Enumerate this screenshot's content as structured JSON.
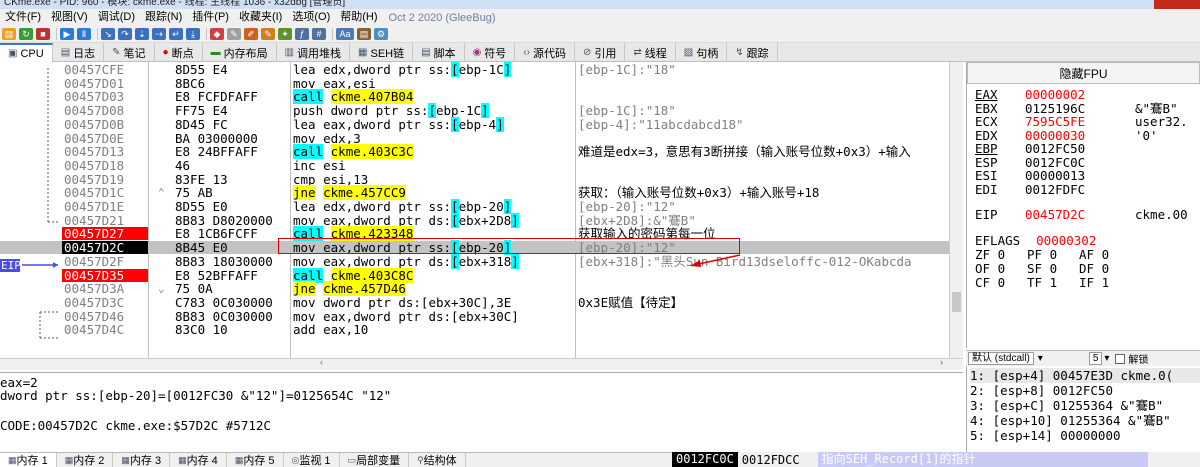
{
  "window": {
    "title": "CKme.exe - PID: 960 - 模块: ckme.exe - 线程: 主线程 1036 - x32dbg [管理员]"
  },
  "menu": {
    "items": [
      "文件(F)",
      "视图(V)",
      "调试(D)",
      "跟踪(N)",
      "插件(P)",
      "收藏夹(I)",
      "选项(O)",
      "帮助(H)"
    ],
    "date": "Oct 2 2020 (GleeBug)"
  },
  "tabs": [
    {
      "label": "CPU",
      "icon": "cpu-icon"
    },
    {
      "label": "日志",
      "icon": "log-icon"
    },
    {
      "label": "笔记",
      "icon": "notes-icon"
    },
    {
      "label": "断点",
      "icon": "breakpoint-icon"
    },
    {
      "label": "内存布局",
      "icon": "memory-map-icon"
    },
    {
      "label": "调用堆栈",
      "icon": "call-stack-icon"
    },
    {
      "label": "SEH链",
      "icon": "seh-icon"
    },
    {
      "label": "脚本",
      "icon": "script-icon"
    },
    {
      "label": "符号",
      "icon": "symbols-icon"
    },
    {
      "label": "源代码",
      "icon": "source-icon"
    },
    {
      "label": "引用",
      "icon": "references-icon"
    },
    {
      "label": "线程",
      "icon": "threads-icon"
    },
    {
      "label": "句柄",
      "icon": "handles-icon"
    },
    {
      "label": "跟踪",
      "icon": "trace-icon"
    }
  ],
  "disasm": [
    {
      "addr": "00457CFE",
      "bytes": "8D55 E4",
      "mark": "",
      "ins": "lea edx,dword ptr ss:",
      "op": "ebp-1C",
      "post": "]",
      "kind": "mem",
      "cmt": "[ebp-1C]:\"18\"",
      "state": ""
    },
    {
      "addr": "00457D01",
      "bytes": "8BC6",
      "mark": "",
      "ins": "mov eax,esi",
      "op": "",
      "post": "",
      "kind": "plain",
      "cmt": "",
      "state": ""
    },
    {
      "addr": "00457D03",
      "bytes": "E8 FCFDFAFF",
      "mark": "",
      "ins": "call",
      "op": "ckme.407B04",
      "post": "",
      "kind": "call",
      "cmt": "",
      "state": ""
    },
    {
      "addr": "00457D08",
      "bytes": "FF75 E4",
      "mark": "",
      "ins": "push dword ptr ss:",
      "op": "ebp-1C",
      "post": "]",
      "kind": "mem",
      "cmt": "[ebp-1C]:\"18\"",
      "state": ""
    },
    {
      "addr": "00457D0B",
      "bytes": "8D45 FC",
      "mark": "",
      "ins": "lea eax,dword ptr ss:",
      "op": "ebp-4",
      "post": "]",
      "kind": "mem",
      "cmt": "[ebp-4]:\"11abcdabcd18\"",
      "state": ""
    },
    {
      "addr": "00457D0E",
      "bytes": "BA 03000000",
      "mark": "",
      "ins": "mov edx,3",
      "op": "",
      "post": "",
      "kind": "plain",
      "cmt": "",
      "state": ""
    },
    {
      "addr": "00457D13",
      "bytes": "E8 24BFFAFF",
      "mark": "",
      "ins": "call",
      "op": "ckme.403C3C",
      "post": "",
      "kind": "call",
      "cmt": "难道是edx=3，意思有3断拼接（输入账号位数+0x3）+输入",
      "state": ""
    },
    {
      "addr": "00457D18",
      "bytes": "46",
      "mark": "",
      "ins": "inc esi",
      "op": "",
      "post": "",
      "kind": "plain",
      "cmt": "",
      "state": ""
    },
    {
      "addr": "00457D19",
      "bytes": "83FE 13",
      "mark": "",
      "ins": "cmp esi,13",
      "op": "",
      "post": "",
      "kind": "plain",
      "cmt": "",
      "state": ""
    },
    {
      "addr": "00457D1C",
      "bytes": "75 AB",
      "mark": "^",
      "ins": "jne",
      "op": "ckme.457CC9",
      "post": "",
      "kind": "jmp",
      "cmt": "获取：（输入账号位数+0x3）+输入账号+18",
      "state": ""
    },
    {
      "addr": "00457D1E",
      "bytes": "8D55 E0",
      "mark": "",
      "ins": "lea edx,dword ptr ss:",
      "op": "ebp-20",
      "post": "]",
      "kind": "mem",
      "cmt": "[ebp-20]:\"12\"",
      "state": ""
    },
    {
      "addr": "00457D21",
      "bytes": "8B83 D8020000",
      "mark": "",
      "ins": "mov eax,dword ptr ds:",
      "op": "ebx+2D8",
      "post": "]",
      "kind": "mem",
      "cmt": "[ebx+2D8]:&\"鶱B\"",
      "state": ""
    },
    {
      "addr": "00457D27",
      "bytes": "E8 1CB6FCFF",
      "mark": "",
      "ins": "call",
      "op": "ckme.423348",
      "post": "",
      "kind": "call",
      "cmt": "获取输入的密码第每一位",
      "state": "bp"
    },
    {
      "addr": "00457D2C",
      "bytes": "8B45 E0",
      "mark": "",
      "ins": "mov eax,dword ptr ss:",
      "op": "ebp-20",
      "post": "]",
      "kind": "mem",
      "cmt": "[ebp-20]:\"12\"",
      "state": "eip"
    },
    {
      "addr": "00457D2F",
      "bytes": "8B83 18030000",
      "mark": "",
      "ins": "mov eax,dword ptr ds:",
      "op": "ebx+318",
      "post": "]",
      "kind": "mem",
      "cmt": "[ebx+318]:\"黑头Sun Bird13dseloffc-012-OKabcda",
      "state": ""
    },
    {
      "addr": "00457D35",
      "bytes": "E8 52BFFAFF",
      "mark": "",
      "ins": "call",
      "op": "ckme.403C8C",
      "post": "",
      "kind": "call",
      "cmt": "",
      "state": "bp"
    },
    {
      "addr": "00457D3A",
      "bytes": "75 0A",
      "mark": "v",
      "ins": "jne",
      "op": "ckme.457D46",
      "post": "",
      "kind": "jmp",
      "cmt": "",
      "state": ""
    },
    {
      "addr": "00457D3C",
      "bytes": "C783 0C030000",
      "mark": "",
      "ins": "mov dword ptr ds:[ebx+30C],3E",
      "op": "",
      "post": "",
      "kind": "plain",
      "cmt": "0x3E赋值【待定】",
      "state": ""
    },
    {
      "addr": "00457D46",
      "bytes": "8B83 0C030000",
      "mark": "",
      "ins": "mov eax,dword ptr ds:[ebx+30C]",
      "op": "",
      "post": "",
      "kind": "plain",
      "cmt": "",
      "state": ""
    },
    {
      "addr": "00457D4C",
      "bytes": "83C0 10",
      "mark": "",
      "ins": "add eax,10",
      "op": "",
      "post": "",
      "kind": "plain",
      "cmt": "",
      "state": ""
    }
  ],
  "eip_label": "EIP",
  "registers": {
    "title": "隐藏FPU",
    "gpr": [
      {
        "name": "EAX",
        "value": "00000002",
        "extra": "",
        "changed": true,
        "u": true
      },
      {
        "name": "EBX",
        "value": "0125196C",
        "extra": "&\"鶱B\"",
        "changed": false,
        "u": false
      },
      {
        "name": "ECX",
        "value": "7595C5FE",
        "extra": "user32.",
        "changed": true,
        "u": false
      },
      {
        "name": "EDX",
        "value": "00000030",
        "extra": "'0'",
        "changed": true,
        "u": false
      },
      {
        "name": "EBP",
        "value": "0012FC50",
        "extra": "",
        "changed": false,
        "u": true
      },
      {
        "name": "ESP",
        "value": "0012FC0C",
        "extra": "",
        "changed": false,
        "u": false
      },
      {
        "name": "ESI",
        "value": "00000013",
        "extra": "",
        "changed": false,
        "u": false
      },
      {
        "name": "EDI",
        "value": "0012FDFC",
        "extra": "",
        "changed": false,
        "u": false
      }
    ],
    "eip": {
      "name": "EIP",
      "value": "00457D2C",
      "extra": "ckme.00"
    },
    "eflags": {
      "name": "EFLAGS",
      "value": "00000302"
    },
    "flags": [
      [
        "ZF",
        "0",
        "PF",
        "0",
        "AF",
        "0"
      ],
      [
        "OF",
        "0",
        "SF",
        "0",
        "DF",
        "0"
      ],
      [
        "CF",
        "0",
        "TF",
        "1",
        "IF",
        "1"
      ]
    ]
  },
  "callconv": {
    "value": "默认 (stdcall)",
    "count": "5",
    "unlock": "解锁"
  },
  "stack_args": [
    "1: [esp+4] 00457E3D ckme.0(",
    "2: [esp+8] 0012FC50",
    "3: [esp+C] 01255364 &\"鶱B\"",
    "4: [esp+10] 01255364 &\"鶱B\"",
    "5: [esp+14] 00000000"
  ],
  "info": [
    "eax=2",
    "dword ptr ss:[ebp-20]=[0012FC30 &\"12\"]=0125654C \"12\"",
    "",
    "CODE:00457D2C ckme.exe:$57D2C #5712C"
  ],
  "bottom_tabs": [
    "内存 1",
    "内存 2",
    "内存 3",
    "内存 4",
    "内存 5",
    "监视 1",
    "局部变量",
    "结构体"
  ],
  "status": {
    "addr1": "0012FC0C",
    "addr2": "0012FDCC",
    "text": "指向SEH_Record[1]的指针"
  },
  "colors": {
    "breakpoint": "#ff0000",
    "eip": "#000000",
    "call_highlight": "#00ffff",
    "jump_highlight": "#ffff00",
    "annotation_box": "#e00000"
  }
}
